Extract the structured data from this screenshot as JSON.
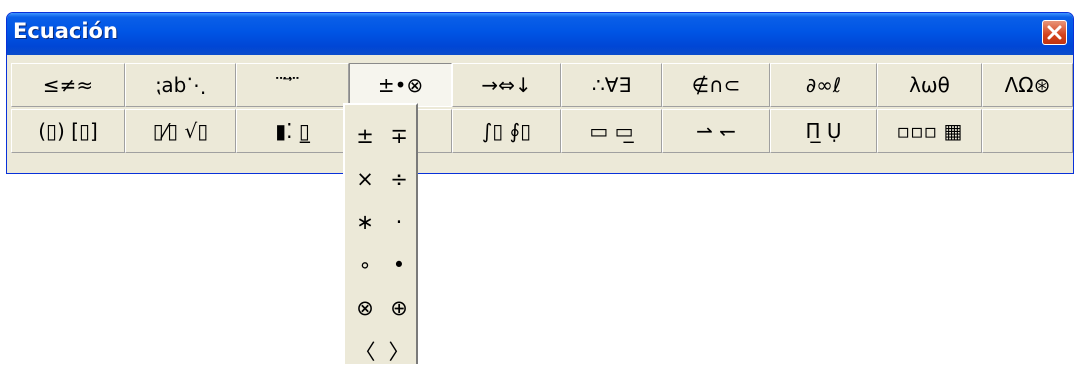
{
  "window": {
    "title": "Ecuación"
  },
  "toolbar": {
    "row1": [
      {
        "name": "relational-symbols-button",
        "label": "≤≠≈"
      },
      {
        "name": "spaces-ellipses-button",
        "label": "⁏ab⋱"
      },
      {
        "name": "embellishments-button",
        "label": "⃛ ⃗ ⃛"
      },
      {
        "name": "operator-symbols-button",
        "label": "±•⊗"
      },
      {
        "name": "arrow-symbols-button",
        "label": "→⇔↓"
      },
      {
        "name": "logical-symbols-button",
        "label": "∴∀∃"
      },
      {
        "name": "set-theory-symbols-button",
        "label": "∉∩⊂"
      },
      {
        "name": "misc-symbols-button",
        "label": "∂∞ℓ"
      },
      {
        "name": "greek-lowercase-button",
        "label": "λωθ"
      },
      {
        "name": "greek-uppercase-button",
        "label": "ΛΩ⊛"
      }
    ],
    "row2": [
      {
        "name": "fence-templates-button",
        "label": "(▯) [▯]"
      },
      {
        "name": "fraction-radical-templates-button",
        "label": "▯⁄▯ √▯"
      },
      {
        "name": "subscript-superscript-templates-button",
        "label": "▮⁚ ▯̲"
      },
      {
        "name": "summation-templates-button",
        "label": "▯"
      },
      {
        "name": "integral-templates-button",
        "label": "∫▯ ∮▯"
      },
      {
        "name": "underbar-overbar-templates-button",
        "label": "▭ ▭̲"
      },
      {
        "name": "labeled-arrow-templates-button",
        "label": "⇀ ↽"
      },
      {
        "name": "product-set-theory-templates-button",
        "label": "Π̲ Ụ"
      },
      {
        "name": "matrix-templates-button",
        "label": "▫▫▫ ▦"
      },
      {
        "name": "empty-slot",
        "label": ""
      }
    ]
  },
  "dropdown": {
    "items": [
      {
        "name": "plus-minus-symbol",
        "label": "±"
      },
      {
        "name": "minus-plus-symbol",
        "label": "∓"
      },
      {
        "name": "times-symbol",
        "label": "×"
      },
      {
        "name": "divide-symbol",
        "label": "÷"
      },
      {
        "name": "asterisk-symbol",
        "label": "∗"
      },
      {
        "name": "dot-operator-symbol",
        "label": "·"
      },
      {
        "name": "ring-operator-symbol",
        "label": "∘"
      },
      {
        "name": "bullet-operator-symbol",
        "label": "•"
      },
      {
        "name": "circled-times-symbol",
        "label": "⊗"
      },
      {
        "name": "circled-plus-symbol",
        "label": "⊕"
      },
      {
        "name": "left-angle-bracket-symbol",
        "label": "〈"
      },
      {
        "name": "right-angle-bracket-symbol",
        "label": "〉"
      }
    ]
  },
  "colors": {
    "titlebar": "#0055e5",
    "toolbar": "#ece9d8",
    "close": "#d3421d"
  },
  "icons": {
    "close": "close-icon"
  }
}
